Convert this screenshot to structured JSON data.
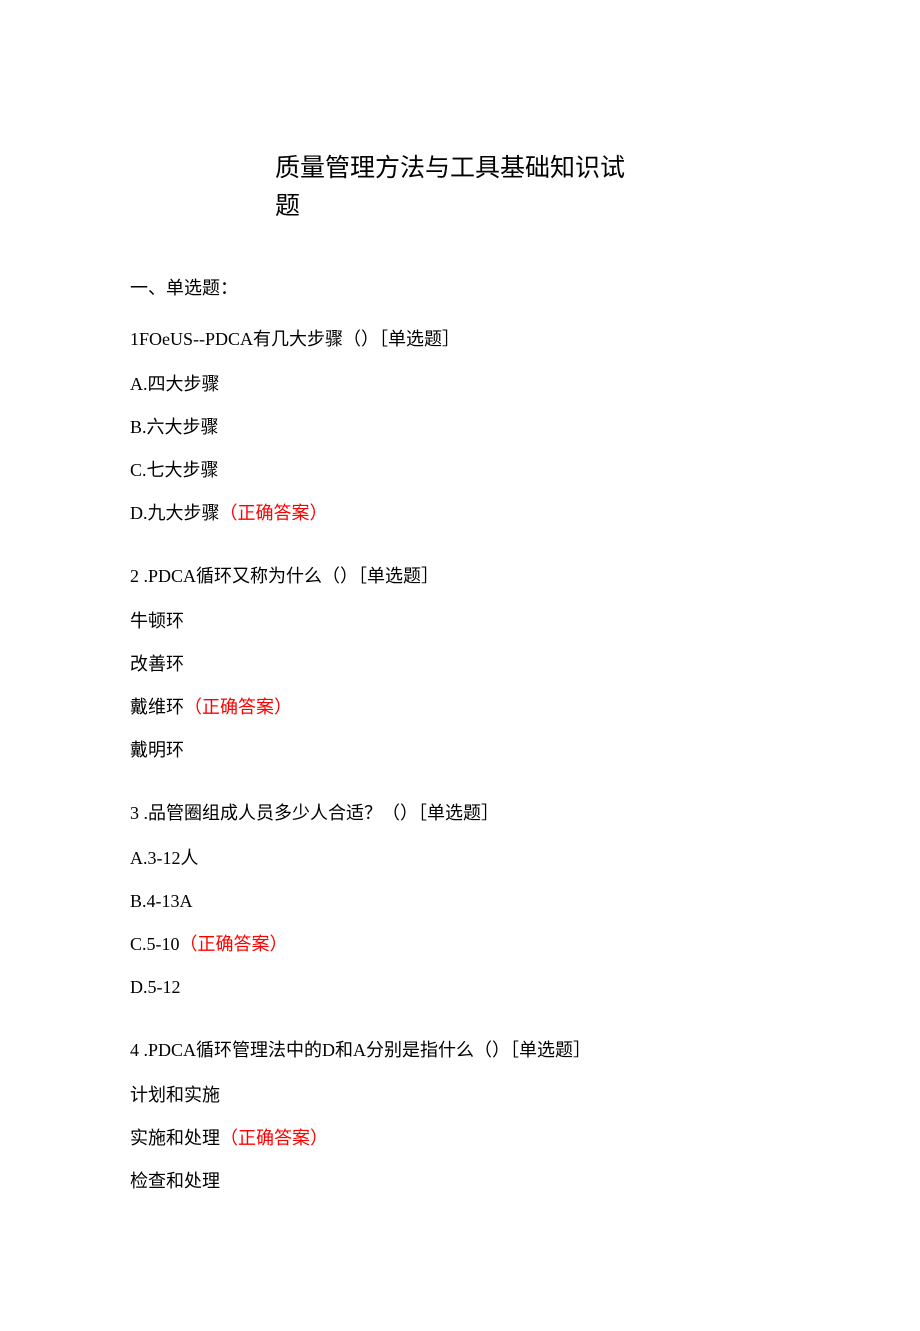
{
  "title": {
    "line1": "质量管理方法与工具基础知识试",
    "line2": "题"
  },
  "sectionHeader": "一、单选题：",
  "questions": [
    {
      "stem": "1FOeUS--PDCA有几大步骤（）［单选题］",
      "options": [
        {
          "text": "A.四大步骤",
          "correct": false,
          "marker": ""
        },
        {
          "text": "B.六大步骤",
          "correct": false,
          "marker": ""
        },
        {
          "text": "C.七大步骤",
          "correct": false,
          "marker": ""
        },
        {
          "text": "D.九大步骤",
          "correct": true,
          "marker": "（正确答案）"
        }
      ]
    },
    {
      "stem": "2   .PDCA循环又称为什么（）［单选题］",
      "options": [
        {
          "text": "牛顿环",
          "correct": false,
          "marker": ""
        },
        {
          "text": "改善环",
          "correct": false,
          "marker": ""
        },
        {
          "text": "戴维环",
          "correct": true,
          "marker": "（正确答案）"
        },
        {
          "text": "戴明环",
          "correct": false,
          "marker": ""
        }
      ]
    },
    {
      "stem": "3   .品管圈组成人员多少人合适？（）［单选题］",
      "options": [
        {
          "text": "A.3-12人",
          "correct": false,
          "marker": ""
        },
        {
          "text": "B.4-13A",
          "correct": false,
          "marker": ""
        },
        {
          "text": "C.5-10",
          "correct": true,
          "marker": "（正确答案）"
        },
        {
          "text": "D.5-12",
          "correct": false,
          "marker": ""
        }
      ]
    },
    {
      "stem": "4   .PDCA循环管理法中的D和A分别是指什么（）［单选题］",
      "options": [
        {
          "text": "计划和实施",
          "correct": false,
          "marker": ""
        },
        {
          "text": "实施和处理",
          "correct": true,
          "marker": "（正确答案）"
        },
        {
          "text": "检查和处理",
          "correct": false,
          "marker": ""
        }
      ]
    }
  ]
}
